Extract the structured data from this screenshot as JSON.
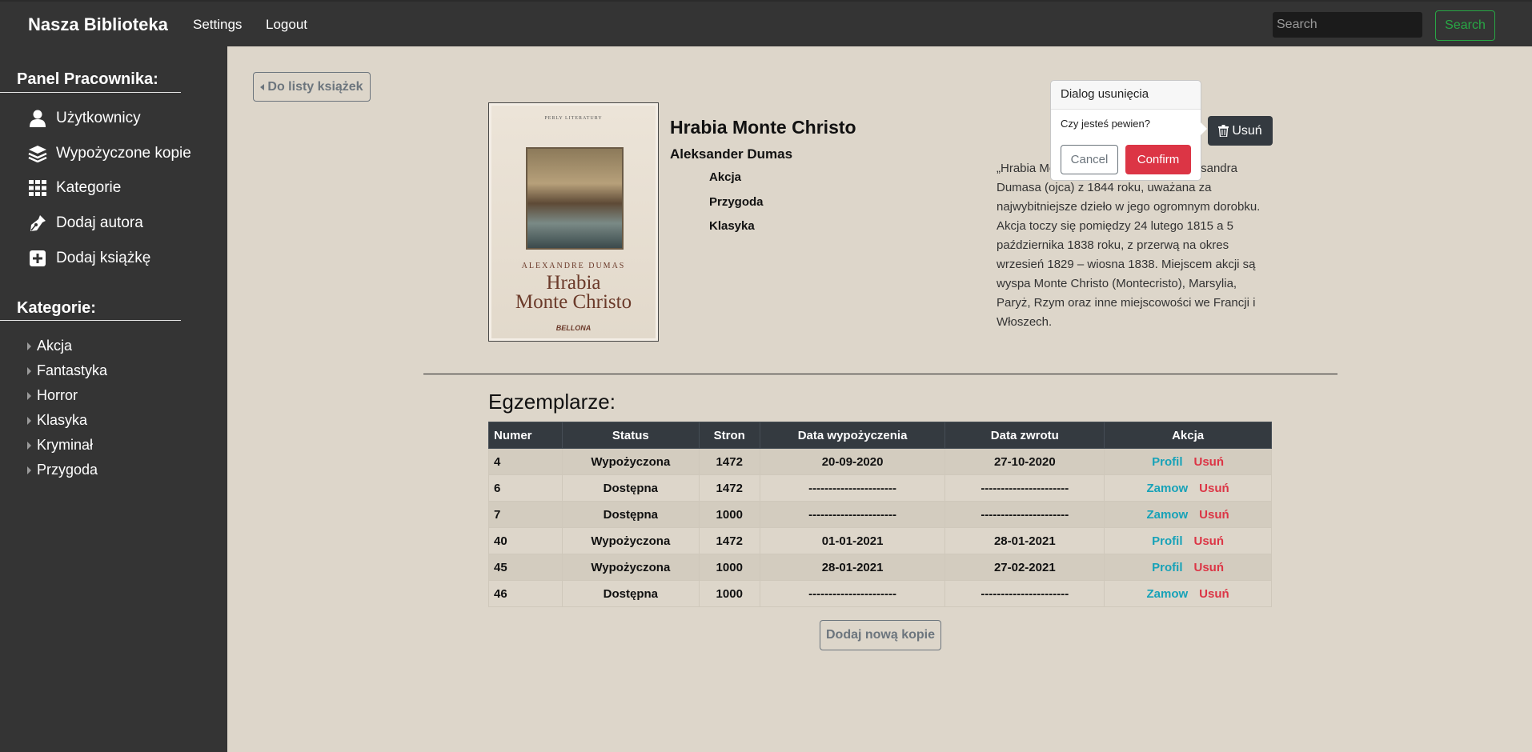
{
  "navbar": {
    "brand": "Nasza Biblioteka",
    "links": [
      "Settings",
      "Logout"
    ],
    "search_placeholder": "Search",
    "search_button": "Search"
  },
  "sidebar": {
    "panel_heading": "Panel  Pracownika:",
    "panel_items": [
      {
        "label": "Użytkownicy",
        "icon": "user-icon"
      },
      {
        "label": "Wypożyczone kopie",
        "icon": "layers-icon"
      },
      {
        "label": "Kategorie",
        "icon": "grid-icon"
      },
      {
        "label": "Dodaj autora",
        "icon": "pen-icon"
      },
      {
        "label": "Dodaj książkę",
        "icon": "plus-square-icon"
      }
    ],
    "categories_heading": "Kategorie:",
    "categories": [
      "Akcja",
      "Fantastyka",
      "Horror",
      "Klasyka",
      "Kryminał",
      "Przygoda"
    ]
  },
  "back_button": "Do listy książek",
  "cover": {
    "top_text": "PERLY LITERATURY",
    "author": "ALEXANDRE DUMAS",
    "title_line1": "Hrabia",
    "title_line2": "Monte Christo",
    "publisher": "BELLONA"
  },
  "book": {
    "title": "Hrabia Monte Christo",
    "author": "Aleksander Dumas",
    "categories": [
      "Akcja",
      "Przygoda",
      "Klasyka"
    ],
    "description": "„Hrabia Monte Christo” – powieść Aleksandra Dumasa (ojca) z 1844 roku, uważana za najwybitniejsze dzieło w jego ogromnym dorobku. Akcja toczy się pomiędzy 24 lutego 1815 a 5 października 1838 roku, z przerwą na okres wrzesień 1829 – wiosna 1838. Miejscem akcji są wyspa Monte Christo (Montecristo), Marsylia, Paryż, Rzym oraz inne miejscowości we Francji i Włoszech.",
    "delete_button": "Usuń"
  },
  "dialog": {
    "title": "Dialog usunięcia",
    "question": "Czy jesteś pewien?",
    "cancel": "Cancel",
    "confirm": "Confirm"
  },
  "copies": {
    "heading": "Egzemplarze:",
    "columns": [
      "Numer",
      "Status",
      "Stron",
      "Data wypożyczenia",
      "Data zwrotu",
      "Akcja"
    ],
    "rows": [
      {
        "numer": "4",
        "status": "Wypożyczona",
        "stron": "1472",
        "data_wyp": "20-09-2020",
        "data_zwr": "27-10-2020",
        "action": "Profil",
        "delete": "Usuń",
        "status_color": "#dc3545"
      },
      {
        "numer": "6",
        "status": "Dostępna",
        "stron": "1472",
        "data_wyp": "----------------------",
        "data_zwr": "----------------------",
        "action": "Zamow",
        "delete": "Usuń",
        "status_color": "#28a745"
      },
      {
        "numer": "7",
        "status": "Dostępna",
        "stron": "1000",
        "data_wyp": "----------------------",
        "data_zwr": "----------------------",
        "action": "Zamow",
        "delete": "Usuń",
        "status_color": "#28a745"
      },
      {
        "numer": "40",
        "status": "Wypożyczona",
        "stron": "1472",
        "data_wyp": "01-01-2021",
        "data_zwr": "28-01-2021",
        "action": "Profil",
        "delete": "Usuń",
        "status_color": "#dc3545"
      },
      {
        "numer": "45",
        "status": "Wypożyczona",
        "stron": "1000",
        "data_wyp": "28-01-2021",
        "data_zwr": "27-02-2021",
        "action": "Profil",
        "delete": "Usuń",
        "status_color": "#dc3545"
      },
      {
        "numer": "46",
        "status": "Dostępna",
        "stron": "1000",
        "data_wyp": "----------------------",
        "data_zwr": "----------------------",
        "action": "Zamow",
        "delete": "Usuń",
        "status_color": "#28a745"
      }
    ],
    "add_button": "Dodaj nową kopie"
  }
}
